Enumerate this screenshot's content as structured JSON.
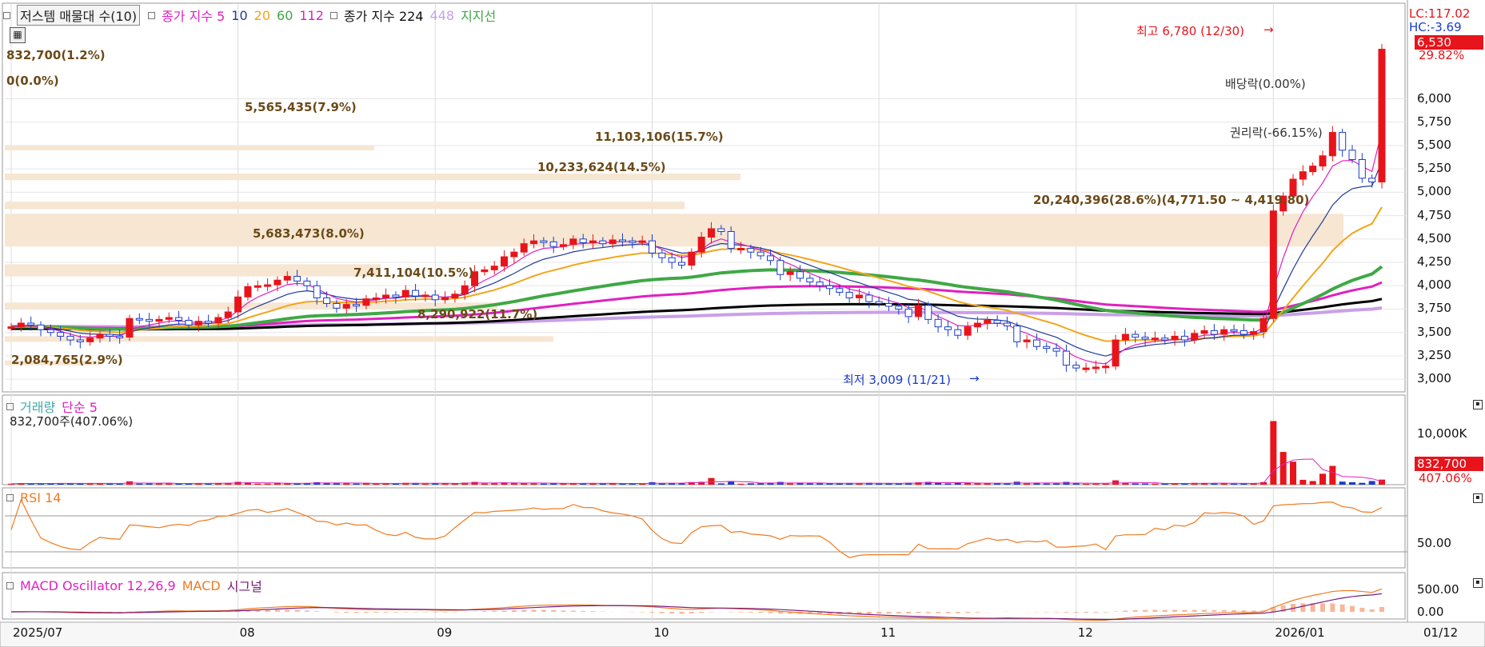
{
  "header": {
    "volume_profile_label": "저스템 매물대 수(10)",
    "ma_title": "종가 지수 5",
    "ma_10": "10",
    "ma_20": "20",
    "ma_60": "60",
    "ma_112": "112",
    "ma_long_title": "종가 지수 224",
    "ma_448": "448",
    "support_label": "지지선",
    "volume_info_1": "832,700(1.2%)",
    "volume_info_2": "0(0.0%)"
  },
  "price_axis": {
    "top_labels": [
      "LC:117.02",
      "HC:-3.69"
    ],
    "current_price": "6,530",
    "change_pct": "29.82%",
    "ticks": [
      "6,000",
      "5,750",
      "5,500",
      "5,250",
      "5,000",
      "4,750",
      "4,500",
      "4,250",
      "4,000",
      "3,750",
      "3,500",
      "3,250",
      "3,000"
    ]
  },
  "annotations": {
    "high": "최고 6,780 (12/30)",
    "low": "최저 3,009 (11/21)",
    "dividend": "배당락(0.00%)",
    "rights": "권리락(-66.15%)"
  },
  "volume_profile": [
    "5,565,435(7.9%)",
    "11,103,106(15.7%)",
    "10,233,624(14.5%)",
    "20,240,396(28.6%)(4,771.50 ~ 4,419.80)",
    "5,683,473(8.0%)",
    "7,411,104(10.5%)",
    "8,290,922(11.7%)",
    "2,084,765(2.9%)"
  ],
  "volume_panel": {
    "title": "거래량",
    "ma_label": "단순 5",
    "info": "832,700주(407.06%)",
    "tick": "10,000K",
    "current": "832,700",
    "pct": "407.06%"
  },
  "rsi_panel": {
    "title": "RSI 14",
    "tick": "50.00"
  },
  "macd_panel": {
    "title": "MACD Oscillator 12,26,9",
    "macd": "MACD",
    "signal": "시그널",
    "ticks": [
      "500.00",
      "0.00"
    ]
  },
  "x_axis": {
    "labels": [
      "2025/07",
      "08",
      "09",
      "10",
      "11",
      "12",
      "2026/01"
    ],
    "right_label": "01/12"
  },
  "colors": {
    "up": "#e8141b",
    "down": "#1a3ccc",
    "ma5": "#e020c0",
    "ma10": "#1e3a9a",
    "ma20": "#f2a51a",
    "ma60": "#3fa845",
    "ma112": "#e020c0",
    "ma224": "#000000",
    "ma448": "#c9a0e8",
    "profile": "#f6e6d2",
    "rsi": "#f07a20",
    "macd": "#f07a20",
    "signal": "#7a1a7a"
  },
  "chart_data": {
    "type": "candlestick",
    "x": [
      "2025-07-01",
      "2025-07-02",
      "2025-07-03",
      "2025-07-04",
      "2025-07-07",
      "2025-07-08",
      "2025-07-09",
      "2025-07-10",
      "2025-07-11",
      "2025-07-14",
      "2025-07-15",
      "2025-07-16",
      "2025-07-17",
      "2025-07-18",
      "2025-07-21",
      "2025-07-22",
      "2025-07-23",
      "2025-07-24",
      "2025-07-25",
      "2025-07-28",
      "2025-07-29",
      "2025-07-30",
      "2025-07-31",
      "2025-08-01",
      "2025-08-04",
      "2025-08-05",
      "2025-08-06",
      "2025-08-07",
      "2025-08-08",
      "2025-08-11",
      "2025-08-12",
      "2025-08-13",
      "2025-08-14",
      "2025-08-18",
      "2025-08-19",
      "2025-08-20",
      "2025-08-21",
      "2025-08-22",
      "2025-08-25",
      "2025-08-26",
      "2025-08-27",
      "2025-08-28",
      "2025-08-29",
      "2025-09-01",
      "2025-09-02",
      "2025-09-03",
      "2025-09-04",
      "2025-09-05",
      "2025-09-08",
      "2025-09-09",
      "2025-09-10",
      "2025-09-11",
      "2025-09-12",
      "2025-09-15",
      "2025-09-16",
      "2025-09-17",
      "2025-09-18",
      "2025-09-19",
      "2025-09-22",
      "2025-09-23",
      "2025-09-24",
      "2025-09-25",
      "2025-09-26",
      "2025-09-29",
      "2025-09-30",
      "2025-10-01",
      "2025-10-02",
      "2025-10-03",
      "2025-10-06",
      "2025-10-07",
      "2025-10-08",
      "2025-10-09",
      "2025-10-10",
      "2025-10-13",
      "2025-10-14",
      "2025-10-15",
      "2025-10-16",
      "2025-10-17",
      "2025-10-20",
      "2025-10-21",
      "2025-10-22",
      "2025-10-23",
      "2025-10-24",
      "2025-10-27",
      "2025-10-28",
      "2025-10-29",
      "2025-10-30",
      "2025-10-31",
      "2025-11-03",
      "2025-11-04",
      "2025-11-05",
      "2025-11-06",
      "2025-11-07",
      "2025-11-10",
      "2025-11-11",
      "2025-11-12",
      "2025-11-13",
      "2025-11-14",
      "2025-11-17",
      "2025-11-18",
      "2025-11-19",
      "2025-11-20",
      "2025-11-21",
      "2025-11-24",
      "2025-11-25",
      "2025-11-26",
      "2025-11-27",
      "2025-11-28",
      "2025-12-01",
      "2025-12-02",
      "2025-12-03",
      "2025-12-04",
      "2025-12-05",
      "2025-12-08",
      "2025-12-09",
      "2025-12-10",
      "2025-12-11",
      "2025-12-12",
      "2025-12-15",
      "2025-12-16",
      "2025-12-17",
      "2025-12-18",
      "2025-12-19",
      "2025-12-22",
      "2025-12-23",
      "2025-12-24",
      "2025-12-26",
      "2025-12-29",
      "2025-12-30",
      "2026-01-02",
      "2026-01-05",
      "2026-01-06",
      "2026-01-07",
      "2026-01-08",
      "2026-01-09",
      "2026-01-12"
    ],
    "close": [
      3560,
      3600,
      3580,
      3530,
      3500,
      3460,
      3420,
      3400,
      3440,
      3480,
      3460,
      3450,
      3650,
      3640,
      3620,
      3640,
      3660,
      3630,
      3580,
      3620,
      3600,
      3660,
      3720,
      3880,
      3990,
      4000,
      4010,
      4060,
      4100,
      4050,
      4000,
      3870,
      3810,
      3760,
      3800,
      3790,
      3860,
      3870,
      3900,
      3880,
      3950,
      3890,
      3900,
      3850,
      3870,
      3910,
      4000,
      4150,
      4170,
      4210,
      4310,
      4360,
      4450,
      4480,
      4470,
      4420,
      4440,
      4500,
      4460,
      4480,
      4450,
      4490,
      4480,
      4470,
      4480,
      4350,
      4300,
      4250,
      4220,
      4360,
      4520,
      4610,
      4580,
      4400,
      4400,
      4360,
      4320,
      4270,
      4120,
      4150,
      4080,
      4040,
      4000,
      3970,
      3930,
      3870,
      3900,
      3830,
      3810,
      3780,
      3750,
      3670,
      3790,
      3640,
      3560,
      3530,
      3470,
      3560,
      3600,
      3630,
      3600,
      3570,
      3400,
      3420,
      3350,
      3330,
      3300,
      3150,
      3120,
      3120,
      3130,
      3140,
      3420,
      3480,
      3450,
      3430,
      3440,
      3420,
      3460,
      3420,
      3490,
      3520,
      3480,
      3530,
      3520,
      3480,
      3510,
      3650,
      4800,
      4960,
      5140,
      5220,
      5280,
      5390,
      5640,
      5450,
      5350,
      5150,
      5110,
      6530
    ],
    "chart_title": "",
    "y_range": [
      3000,
      6780
    ],
    "volume_ticks": [
      "10,000K"
    ],
    "ma_periods": [
      5,
      10,
      20,
      60,
      112,
      224,
      448
    ]
  }
}
